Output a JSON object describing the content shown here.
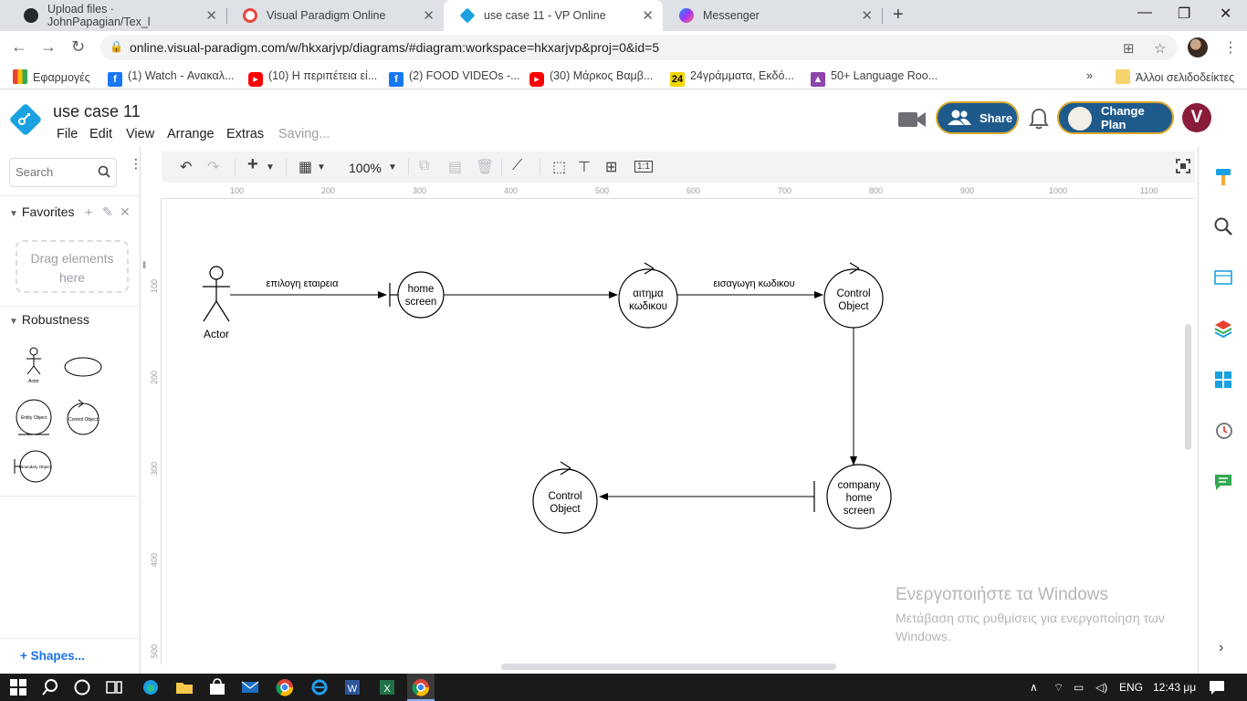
{
  "browser": {
    "tabs": [
      {
        "title": "Upload files · JohnPapagian/Tex_l",
        "active": false
      },
      {
        "title": "Visual Paradigm Online",
        "active": false
      },
      {
        "title": "use case 11 - VP Online",
        "active": true
      },
      {
        "title": "Messenger",
        "active": false
      }
    ],
    "url": "online.visual-paradigm.com/w/hkxarjvp/diagrams/#diagram:workspace=hkxarjvp&proj=0&id=5",
    "bookmarks": [
      {
        "label": "Εφαρμογές",
        "icon": "apps-grid-icon",
        "color": "#e94235"
      },
      {
        "label": "(1) Watch - Ανακαλ...",
        "icon": "facebook-icon",
        "color": "#1877f2"
      },
      {
        "label": "(10) Η περιπέτεια εί...",
        "icon": "youtube-icon",
        "color": "#ff0000"
      },
      {
        "label": "(2) FOOD VIDEOs -...",
        "icon": "facebook-icon",
        "color": "#1877f2"
      },
      {
        "label": "(30) Μάρκος Βαμβ...",
        "icon": "youtube-icon",
        "color": "#ff0000"
      },
      {
        "label": "24γράμματα, Εκδό...",
        "icon": "24-icon",
        "color": "#f2d600"
      },
      {
        "label": "50+ Language Roo...",
        "icon": "language-icon",
        "color": "#8e44ad"
      }
    ],
    "bookmarks_more": "»",
    "other_bookmarks": "Άλλοι σελιδοδείκτες"
  },
  "app": {
    "title": "use case 11",
    "menu": [
      "File",
      "Edit",
      "View",
      "Arrange",
      "Extras"
    ],
    "status": "Saving...",
    "share_label": "Share",
    "plan_label": "Change Plan",
    "avatar_letter": "V",
    "brand_color": "#1f5a8c",
    "accent_border": "#d9a92d"
  },
  "left_panel": {
    "search_placeholder": "Search",
    "favorites_label": "Favorites",
    "dropzone_text_1": "Drag elements",
    "dropzone_text_2": "here",
    "robustness_label": "Robustness",
    "shapes_link": "+ Shapes...",
    "palette": {
      "actor": "Actor",
      "entity": "Entity Object",
      "control": "Control Object",
      "boundary": "Boundary Object"
    }
  },
  "toolbar": {
    "zoom": "100%"
  },
  "rulers": {
    "top": [
      "100",
      "200",
      "300",
      "400",
      "500",
      "600",
      "700",
      "800",
      "900",
      "1000",
      "1100"
    ],
    "left": [
      "100",
      "200",
      "300",
      "400",
      "500"
    ]
  },
  "diagram": {
    "actor_label": "Actor",
    "edge_1_label": "επιλογη εταιρεια",
    "home_screen_l1": "home",
    "home_screen_l2": "screen",
    "request_l1": "αιτημα",
    "request_l2": "κωδικου",
    "edge_2_label": "εισαγωγη κωδικου",
    "control_1_l1": "Control",
    "control_1_l2": "Object",
    "company_l1": "company",
    "company_l2": "home",
    "company_l3": "screen",
    "control_2_l1": "Control",
    "control_2_l2": "Object"
  },
  "watermark": {
    "title": "Ενεργοποιήστε τα Windows",
    "line1": "Μετάβαση στις ρυθμίσεις για ενεργοποίηση των",
    "line2": "Windows."
  },
  "taskbar": {
    "lang": "ENG",
    "time": "12:43 μμ"
  }
}
